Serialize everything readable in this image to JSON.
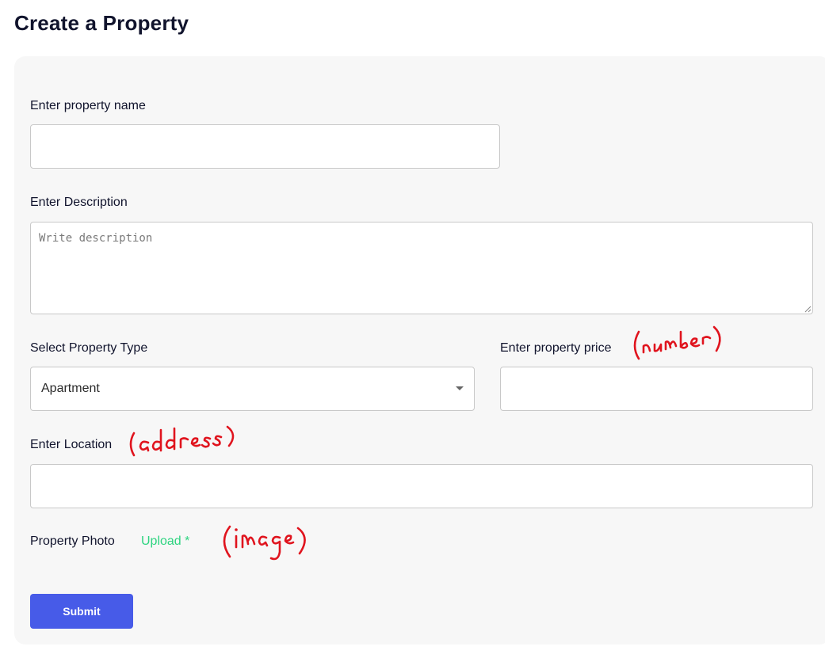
{
  "page": {
    "title": "Create a Property"
  },
  "form": {
    "name_label": "Enter property name",
    "name_value": "",
    "description_label": "Enter Description",
    "description_placeholder": "Write description",
    "type_label": "Select Property Type",
    "type_selected": "Apartment",
    "price_label": "Enter property price",
    "price_value": "",
    "location_label": "Enter Location",
    "location_value": "",
    "photo_label": "Property Photo",
    "upload_label": "Upload *",
    "submit_label": "Submit"
  },
  "annotations": {
    "price_note": "(number)",
    "location_note": "(address)",
    "photo_note": "(image)",
    "ink_color": "#e0141e"
  },
  "colors": {
    "accent": "#475be8",
    "upload": "#2ed480",
    "card_background": "#f7f7f7"
  }
}
